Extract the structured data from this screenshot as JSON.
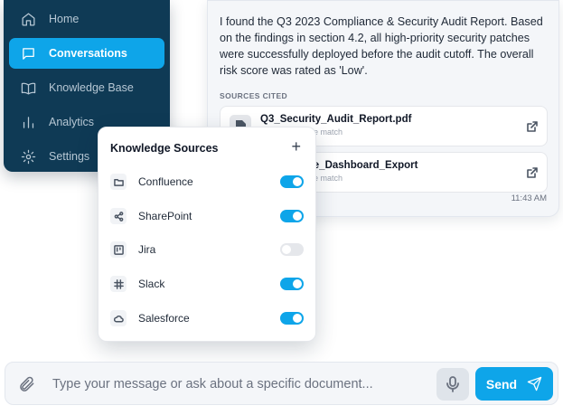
{
  "sidebar": {
    "items": [
      {
        "label": "Home",
        "icon": "home-icon",
        "active": false
      },
      {
        "label": "Conversations",
        "icon": "chat-icon",
        "active": true
      },
      {
        "label": "Knowledge Base",
        "icon": "book-icon",
        "active": false
      },
      {
        "label": "Analytics",
        "icon": "bar-chart-icon",
        "active": false
      },
      {
        "label": "Settings",
        "icon": "gear-icon",
        "active": false
      }
    ]
  },
  "message": {
    "text": "I found the Q3 2023 Compliance & Security Audit Report. Based on the findings in section 4.2, all high-priority security patches were successfully deployed before the audit cutoff. The overall risk score was rated as 'Low'.",
    "sources_title": "SOURCES CITED",
    "sources": [
      {
        "name": "Q3_Security_Audit_Report.pdf",
        "sub": "98% confidence match"
      },
      {
        "name": "Compliance_Dashboard_Export",
        "sub": "85% confidence match"
      }
    ],
    "time": "11:43 AM"
  },
  "knowledge_sources": {
    "title": "Knowledge Sources",
    "add_label": "+",
    "items": [
      {
        "label": "Confluence",
        "icon": "folder-icon",
        "enabled": true
      },
      {
        "label": "SharePoint",
        "icon": "share-icon",
        "enabled": true
      },
      {
        "label": "Jira",
        "icon": "board-icon",
        "enabled": false
      },
      {
        "label": "Slack",
        "icon": "slack-icon",
        "enabled": true
      },
      {
        "label": "Salesforce",
        "icon": "cloud-icon",
        "enabled": true
      }
    ]
  },
  "input": {
    "placeholder": "Type your message or ask about a specific document...",
    "value": ""
  },
  "send_label": "Send",
  "colors": {
    "accent": "#0ea5e9",
    "sidebar_bg": "#0f3a55"
  }
}
